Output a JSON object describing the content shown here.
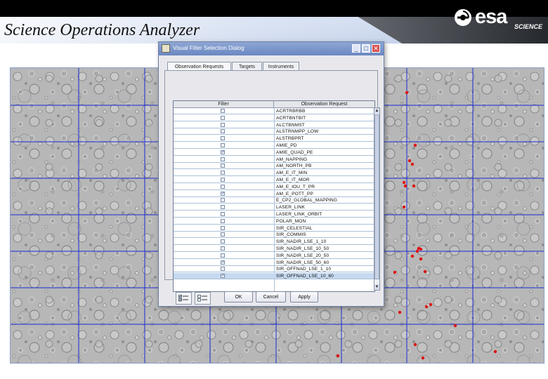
{
  "header": {
    "title": "Science Operations Analyzer",
    "logo_text": "esa",
    "logo_subtext": "SCIENCE"
  },
  "map": {
    "grid_color": "#1a2bd0",
    "marker_color": "#e01010",
    "marker_count": 24
  },
  "dialog": {
    "title": "Visual Filter Selection Dialog",
    "window_buttons": {
      "minimize": "_",
      "maximize": "□",
      "close": "✕"
    },
    "tabs": [
      {
        "label": "Observation Requests",
        "active": true
      },
      {
        "label": "Targets",
        "active": false
      },
      {
        "label": "Instruments",
        "active": false
      }
    ],
    "table": {
      "headers": {
        "filter": "Filter",
        "request": "Observation Request"
      },
      "rows": [
        {
          "checked": false,
          "request": "ACRTRBRBB"
        },
        {
          "checked": false,
          "request": "ACRTBNTBIT"
        },
        {
          "checked": false,
          "request": "ALCTBNMST"
        },
        {
          "checked": false,
          "request": "ALSTRNMPP_LOW"
        },
        {
          "checked": false,
          "request": "ALSTRBPRT"
        },
        {
          "checked": false,
          "request": "AMIE_PD"
        },
        {
          "checked": true,
          "request": "AMIE_QUAD_PE"
        },
        {
          "checked": false,
          "request": "AM_NAPPING"
        },
        {
          "checked": false,
          "request": "AM_NORTH_PB"
        },
        {
          "checked": false,
          "request": "AM_E_IT_MIN"
        },
        {
          "checked": false,
          "request": "AM_E_IT_MOR"
        },
        {
          "checked": false,
          "request": "AM_E_IOU_T_PR"
        },
        {
          "checked": true,
          "request": "AM_E_POTT_PP"
        },
        {
          "checked": false,
          "request": "E_CP2_GLOBAL_MAPPING"
        },
        {
          "checked": false,
          "request": "LASER_LINK"
        },
        {
          "checked": false,
          "request": "LASER_LINK_ORBIT"
        },
        {
          "checked": false,
          "request": "POLAR_MON"
        },
        {
          "checked": false,
          "request": "SIR_CELESTIAL"
        },
        {
          "checked": false,
          "request": "SIR_COMMIS"
        },
        {
          "checked": false,
          "request": "SIR_NADIR_LSE_1_10"
        },
        {
          "checked": false,
          "request": "SIR_NADIR_LSE_10_50"
        },
        {
          "checked": false,
          "request": "SIR_NADIR_LSE_20_50"
        },
        {
          "checked": true,
          "request": "SIR_NADIR_LSE_50_60"
        },
        {
          "checked": false,
          "request": "SIR_OFFNAD_LSE_1_10"
        },
        {
          "checked": true,
          "request": "SIR_OFFNAD_LSE_10_60",
          "selected": true
        }
      ]
    },
    "buttons": {
      "ok": "OK",
      "cancel": "Cancel",
      "apply": "Apply"
    }
  }
}
